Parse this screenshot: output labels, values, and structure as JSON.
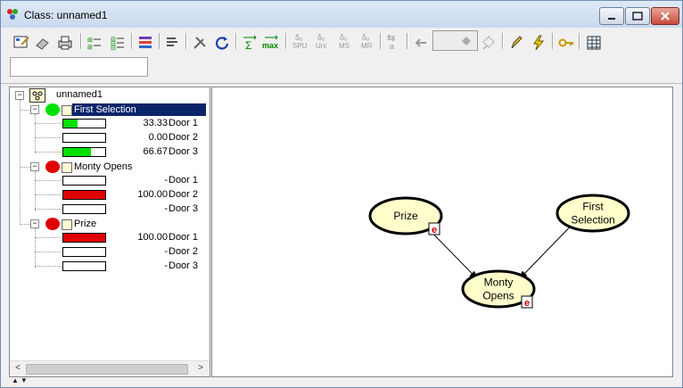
{
  "window": {
    "title": "Class: unnamed1",
    "buttons": {
      "minimize": "minimize",
      "maximize": "maximize",
      "close": "close"
    }
  },
  "toolbar": {
    "search_value": "",
    "groups": [
      [
        "properties-icon",
        "eraser-icon",
        "print-icon"
      ],
      [
        "expand-tree-icon",
        "collapse-tree-icon"
      ],
      [
        "chart-color-icon"
      ],
      [
        "align-icon"
      ],
      [
        "tools-icon",
        "refresh-icon"
      ],
      [
        "sum-propagate-icon",
        "max-propagate-icon"
      ],
      [
        "spu-icon",
        "uni-icon",
        "ms-icon",
        "mr-icon"
      ],
      [
        "arrow-a-icon"
      ],
      [
        "left-arrow-icon",
        "value-box",
        "diamond-icon"
      ],
      [
        "pencil-icon",
        "lightning-icon"
      ],
      [
        "key-icon"
      ],
      [
        "grid-icon"
      ]
    ],
    "labels": {
      "sum": "Σ",
      "max": "max",
      "spu_top": "δᵤ",
      "spu": "SPU",
      "uni_top": "δᵤ",
      "uni": "Uni",
      "ms_top": "δᵤ",
      "ms": "MS",
      "mr_top": "δᵤ",
      "mr": "MR",
      "a_top": "⇆",
      "a": "a"
    }
  },
  "tree": {
    "root": {
      "label": "unnamed1",
      "expanded": true
    },
    "nodes": [
      {
        "name": "First  Selection",
        "status_color": "#00e000",
        "selected": true,
        "states": [
          {
            "value": "33.33",
            "state": "Door 1",
            "fill": 0.3333,
            "color": "#00e000"
          },
          {
            "value": "0.00",
            "state": "Door 2",
            "fill": 0.0,
            "color": "#00e000"
          },
          {
            "value": "66.67",
            "state": "Door 3",
            "fill": 0.6667,
            "color": "#00e000"
          }
        ]
      },
      {
        "name": "Monty  Opens",
        "status_color": "#e00000",
        "selected": false,
        "states": [
          {
            "value": "-",
            "state": "Door 1",
            "fill": 0.0,
            "color": "#e00000"
          },
          {
            "value": "100.00",
            "state": "Door 2",
            "fill": 1.0,
            "color": "#e00000"
          },
          {
            "value": "-",
            "state": "Door 3",
            "fill": 0.0,
            "color": "#e00000"
          }
        ]
      },
      {
        "name": "Prize",
        "status_color": "#e00000",
        "selected": false,
        "states": [
          {
            "value": "100.00",
            "state": "Door 1",
            "fill": 1.0,
            "color": "#e00000"
          },
          {
            "value": "-",
            "state": "Door 2",
            "fill": 0.0,
            "color": "#e00000"
          },
          {
            "value": "-",
            "state": "Door 3",
            "fill": 0.0,
            "color": "#e00000"
          }
        ]
      }
    ]
  },
  "network": {
    "nodes": [
      {
        "id": "prize",
        "label_lines": [
          "Prize"
        ],
        "evidence": "e"
      },
      {
        "id": "first",
        "label_lines": [
          "First",
          "Selection"
        ],
        "evidence": ""
      },
      {
        "id": "monty",
        "label_lines": [
          "Monty",
          "Opens"
        ],
        "evidence": "e"
      }
    ],
    "edges": [
      {
        "from": "prize",
        "to": "monty"
      },
      {
        "from": "first",
        "to": "monty"
      }
    ],
    "node_fill": "#ffffcc",
    "evidence_color": "#cc0000"
  }
}
